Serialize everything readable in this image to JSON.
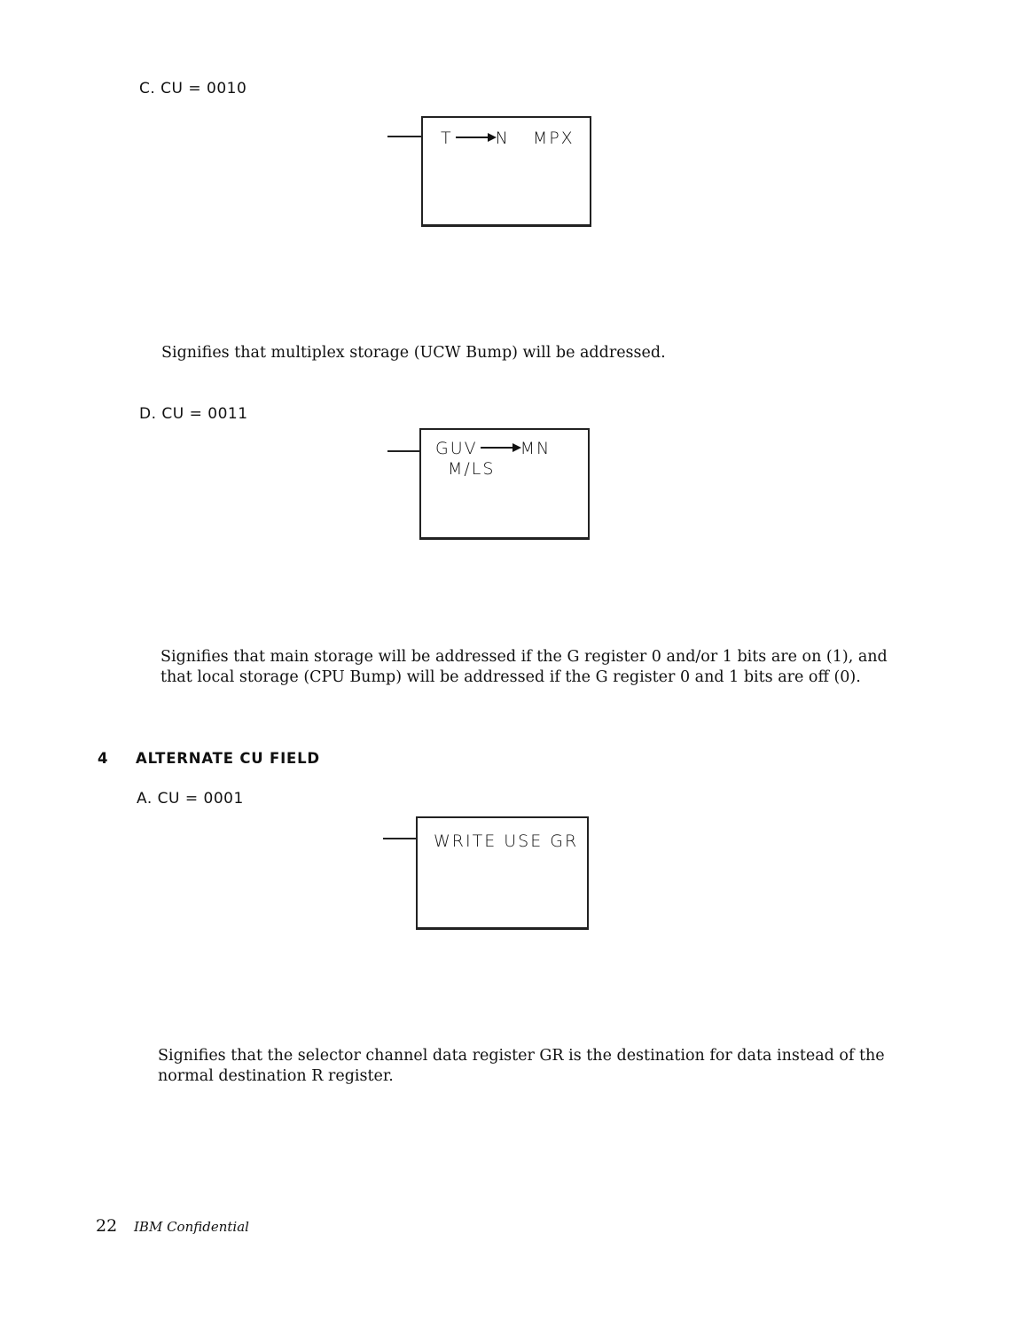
{
  "sections": {
    "c": {
      "label": "C. CU = 0010",
      "box": {
        "line1_from": "T",
        "line1_to": "N",
        "line1_suffix": "MPX",
        "arrow_icon": "right-arrow"
      },
      "description": "Signifies that multiplex storage (UCW Bump) will be addressed."
    },
    "d": {
      "label": "D. CU = 0011",
      "box": {
        "line1_from": "GUV",
        "line1_to": "MN",
        "line2": "M/LS",
        "arrow_icon": "right-arrow"
      },
      "description": "Signifies that main storage will be addressed if the G register 0 and/or 1 bits are on (1), and that local storage (CPU Bump) will be addressed if the G register 0 and 1 bits are off (0)."
    }
  },
  "heading": {
    "number": "4",
    "title": "ALTERNATE CU FIELD"
  },
  "alternate": {
    "a": {
      "label": "A. CU = 0001",
      "box": {
        "line1": "WRITE USE GR"
      },
      "description": "Signifies that the selector channel data register GR is the destination for data instead of the normal destination R register."
    }
  },
  "footer": {
    "page_number": "22",
    "confidentiality": "IBM Confidential"
  }
}
